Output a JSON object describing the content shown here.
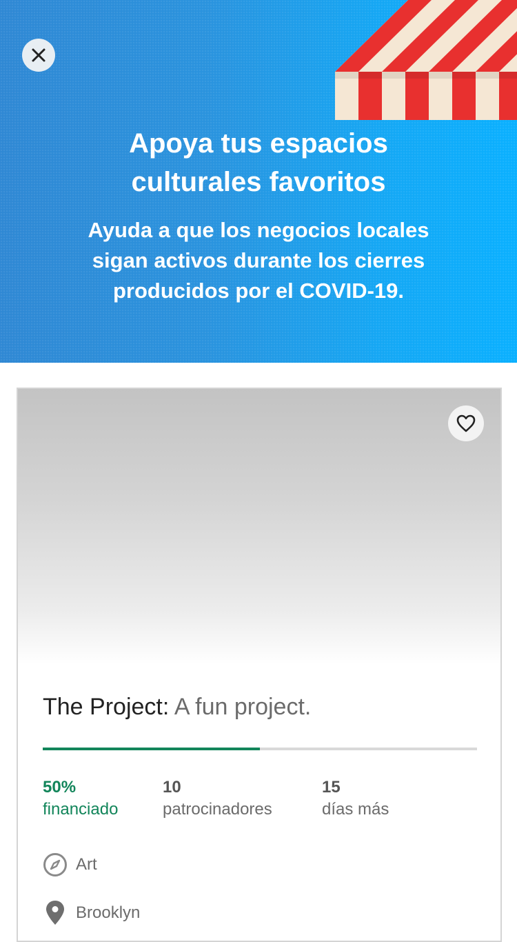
{
  "hero": {
    "title_lines": [
      "Apoya tus espacios",
      "culturales favoritos"
    ],
    "subtitle_lines": [
      "Ayuda a que los negocios locales",
      "sigan activos durante los cierres",
      "producidos por el COVID-19."
    ],
    "close_icon": "close-icon",
    "decoration_icon": "awning-icon"
  },
  "project": {
    "name": "The Project:",
    "blurb": "A fun project.",
    "favorite_icon": "heart-icon",
    "percent_funded": 0.5,
    "stats": {
      "funded_value": "50%",
      "funded_label": "financiado",
      "backers_value": "10",
      "backers_label": "patrocinadores",
      "days_value": "15",
      "days_label": "días más"
    },
    "category": "Art",
    "location": "Brooklyn"
  },
  "colors": {
    "funded_green": "#12855a",
    "hero_blue": "#0ab0ff",
    "awning_red": "#e8302f"
  }
}
